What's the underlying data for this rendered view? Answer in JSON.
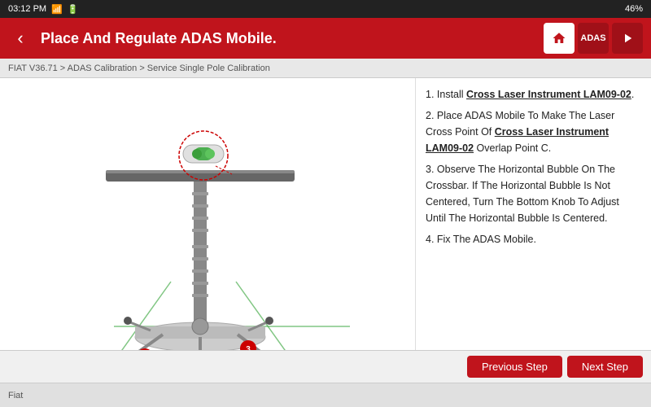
{
  "statusBar": {
    "time": "03:12 PM",
    "wifi": "📶",
    "battery": "46%"
  },
  "header": {
    "title": "Place And Regulate ADAS Mobile.",
    "backLabel": "‹",
    "icons": [
      "🏠",
      "📋",
      "➤"
    ]
  },
  "breadcrumb": "FIAT V36.71 > ADAS Calibration > Service Single Pole Calibration",
  "instructions": [
    {
      "num": "1",
      "text": "Install ",
      "bold": "Cross Laser Instrument LAM09-02",
      "rest": "."
    },
    {
      "num": "2",
      "text": "Place ADAS Mobile To Make The Laser Cross Point Of ",
      "bold": "Cross Laser Instrument LAM09-02",
      "rest": " Overlap Point C."
    },
    {
      "num": "3",
      "text": "Observe The Horizontal Bubble On The Crossbar. If The Horizontal Bubble Is Not Centered, Turn The Bottom Knob To Adjust Until The Horizontal Bubble Is Centered."
    },
    {
      "num": "4",
      "text": "Fix The ADAS Mobile."
    }
  ],
  "footer": {
    "prevLabel": "Previous Step",
    "nextLabel": "Next Step"
  },
  "bottomBar": {
    "brand": "Fiat"
  }
}
